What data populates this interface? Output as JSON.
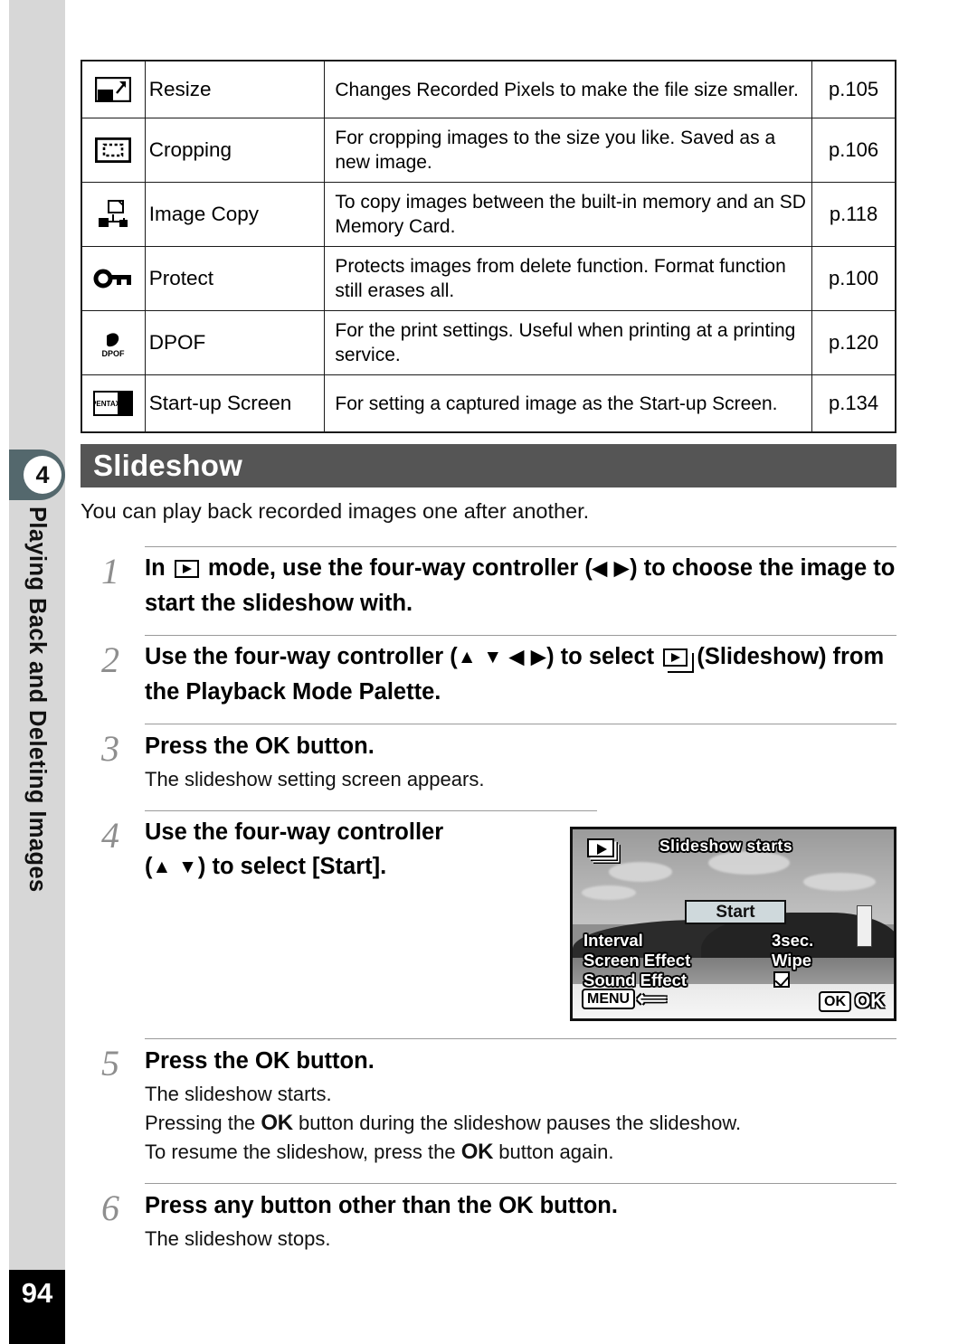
{
  "sidebar": {
    "chapter_number": "4",
    "chapter_title": "Playing Back and Deleting Images",
    "page_number": "94",
    "tab_color": "#54686d"
  },
  "features_table": {
    "rows": [
      {
        "icon": "resize-icon",
        "label": "Resize",
        "description": "Changes Recorded Pixels to make the file size smaller.",
        "page_ref": "p.105"
      },
      {
        "icon": "cropping-icon",
        "label": "Cropping",
        "description": "For cropping images to the size you like. Saved as a new image.",
        "page_ref": "p.106"
      },
      {
        "icon": "image-copy-icon",
        "label": "Image Copy",
        "description": "To copy images between the built-in memory and an SD Memory Card.",
        "page_ref": "p.118"
      },
      {
        "icon": "protect-key-icon",
        "label": "Protect",
        "description": "Protects images from delete function. Format function still erases all.",
        "page_ref": "p.100"
      },
      {
        "icon": "dpof-icon",
        "label": "DPOF",
        "description": "For the print settings. Useful when printing at a printing service.",
        "page_ref": "p.120"
      },
      {
        "icon": "start-up-screen-icon",
        "label": "Start-up Screen",
        "description": "For setting a captured image as the Start-up Screen.",
        "page_ref": "p.134"
      }
    ]
  },
  "section": {
    "heading": "Slideshow",
    "heading_bg": "#555555",
    "intro": "You can play back recorded images one after another."
  },
  "steps": [
    {
      "number": "1",
      "title_part1": "In",
      "title_part2": "mode, use the four-way controller (",
      "arrows": "◀ ▶",
      "title_part3": ") to choose the image to start the slideshow with."
    },
    {
      "number": "2",
      "title_part1": "Use the four-way controller (",
      "arrows": "▲ ▼ ◀ ▶",
      "title_part2": ") to select",
      "title_part3": "(Slideshow) from the Playback Mode Palette."
    },
    {
      "number": "3",
      "title_part1": "Press the",
      "ok": "OK",
      "title_part2": "button.",
      "note": "The slideshow setting screen appears."
    },
    {
      "number": "4",
      "title_part1": "Use the four-way controller",
      "title_part2": "(",
      "arrows": "▲ ▼",
      "title_part3": ") to select [Start]."
    },
    {
      "number": "5",
      "title_part1": "Press the",
      "ok": "OK",
      "title_part2": "button.",
      "note_line1": "The slideshow starts.",
      "note_line2_a": "Pressing the",
      "note_line2_ok": "OK",
      "note_line2_b": "button during the slideshow pauses the slideshow.",
      "note_line3_a": "To resume the slideshow, press the",
      "note_line3_ok": "OK",
      "note_line3_b": "button again."
    },
    {
      "number": "6",
      "title_part1": "Press any button other than the",
      "ok": "OK",
      "title_part2": "button.",
      "note": "The slideshow stops."
    }
  ],
  "lcd_screen": {
    "title": "Slideshow starts",
    "mode_icon": "playback-stack-icon",
    "start_button": "Start",
    "settings": [
      {
        "name": "Interval",
        "value": "3sec."
      },
      {
        "name": "Screen Effect",
        "value": "Wipe"
      },
      {
        "name": "Sound Effect",
        "value": "checkbox-checked"
      }
    ],
    "menu_button": "MENU",
    "ok_button_pill": "OK",
    "ok_button_label": "OK"
  }
}
